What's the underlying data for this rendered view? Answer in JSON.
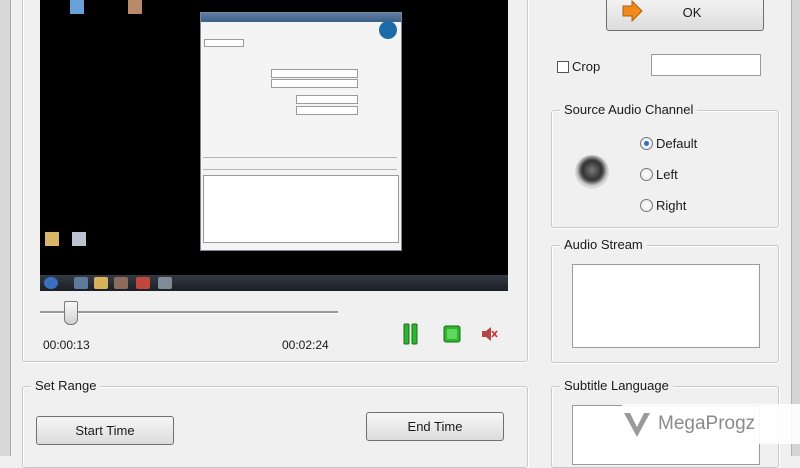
{
  "preview": {
    "current_time": "00:00:13",
    "total_time": "00:02:24",
    "position_fraction": 0.09
  },
  "buttons": {
    "ok": "OK",
    "start_time": "Start Time",
    "end_time": "End Time"
  },
  "crop": {
    "label": "Crop",
    "checked": false,
    "value": ""
  },
  "source_audio": {
    "title": "Source Audio Channel",
    "options": [
      "Default",
      "Left",
      "Right"
    ],
    "selected": "Default"
  },
  "audio_stream": {
    "title": "Audio Stream"
  },
  "subtitle_language": {
    "title": "Subtitle Language"
  },
  "set_range": {
    "title": "Set Range"
  },
  "watermark": {
    "text": "MegaProgz"
  },
  "colors": {
    "play_green": "#2db52d",
    "mute_red": "#c83232",
    "ok_arrow": "#f08a1c"
  }
}
